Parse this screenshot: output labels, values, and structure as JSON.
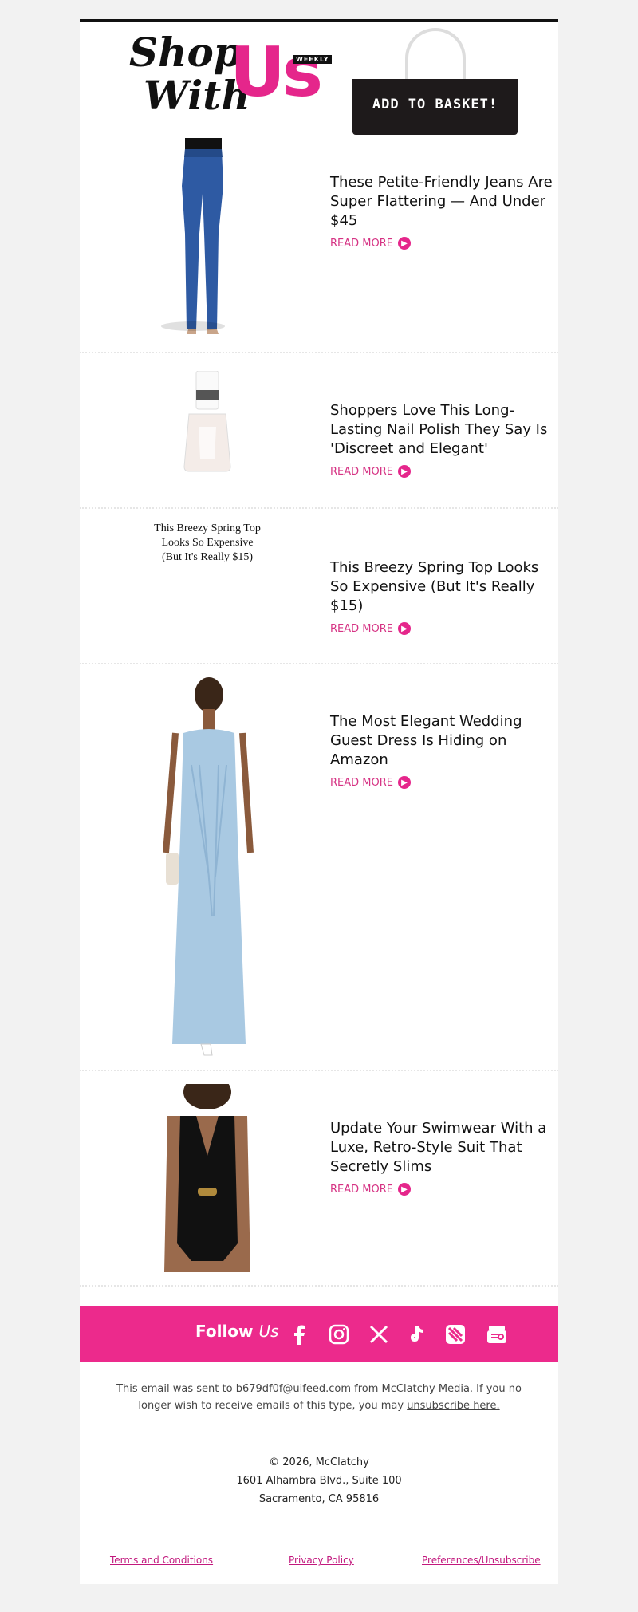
{
  "header": {
    "logo_shop": "Shop",
    "logo_with": "With",
    "logo_us": "Us",
    "logo_weekly": "WEEKLY",
    "bag_label": "ADD TO BASKET!"
  },
  "items": [
    {
      "title": "These Petite-Friendly Jeans Are Super Flattering — And Under $45",
      "cta": "READ MORE",
      "image": "jeans-photo"
    },
    {
      "title": "Shoppers Love This Long-Lasting Nail Polish They Say Is 'Discreet and Elegant'",
      "cta": "READ MORE",
      "image": "nail-polish-photo"
    },
    {
      "title": "This Breezy Spring Top Looks So Expensive (But It's Really $15)",
      "cta": "READ MORE",
      "image_alt": "This Breezy Spring Top Looks So Expensive (But It's Really $15)"
    },
    {
      "title": "The Most Elegant Wedding Guest Dress Is Hiding on Amazon",
      "cta": "READ MORE",
      "image": "dress-photo"
    },
    {
      "title": "Update Your Swimwear With a Luxe, Retro-Style Suit That Secretly Slims",
      "cta": "READ MORE",
      "image": "swimsuit-photo"
    }
  ],
  "follow": {
    "label_prefix": "Follow",
    "label_brand": "Us",
    "icons": [
      "facebook-icon",
      "instagram-icon",
      "x-icon",
      "tiktok-icon",
      "apple-news-icon",
      "google-news-icon"
    ]
  },
  "footer": {
    "note_prefix": "This email was sent to",
    "email": "b679df0f@uifeed.com",
    "note_middle": "from McClatchy Media. If you no longer wish to receive emails of this type, you may",
    "unsubscribe": "unsubscribe here.",
    "copyright": "© 2026, McClatchy",
    "address_line1": "1601 Alhambra Blvd., Suite 100",
    "address_line2": "Sacramento, CA 95816",
    "links": [
      "Terms and Conditions",
      "Privacy Policy",
      "Preferences/Unsubscribe"
    ]
  },
  "colors": {
    "accent": "#ec2a8c",
    "link": "#d63384",
    "bag": "#1e1a1b"
  }
}
